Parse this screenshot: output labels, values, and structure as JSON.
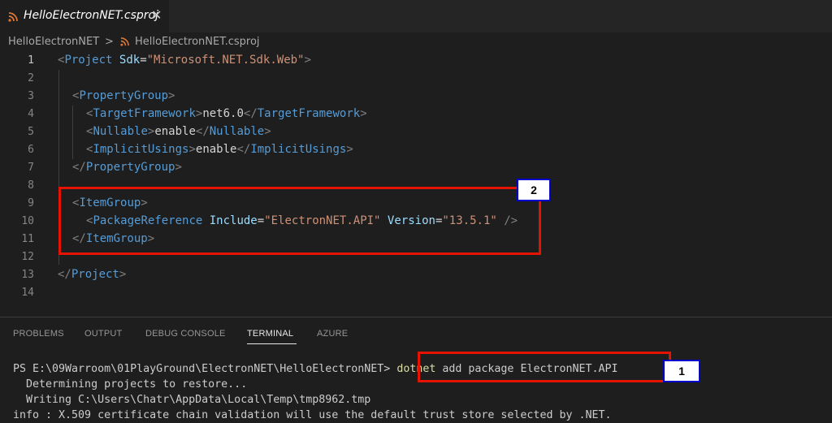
{
  "tab": {
    "title": "HelloElectronNET.csproj",
    "close": "✕"
  },
  "breadcrumb": {
    "folder": "HelloElectronNET",
    "sep": ">",
    "file": "HelloElectronNET.csproj"
  },
  "line_numbers": [
    "1",
    "2",
    "3",
    "4",
    "5",
    "6",
    "7",
    "8",
    "9",
    "10",
    "11",
    "12",
    "13",
    "14"
  ],
  "code": {
    "l1": {
      "open": "<",
      "tag": "Project",
      "attr": "Sdk",
      "eq": "=",
      "val": "\"Microsoft.NET.Sdk.Web\"",
      "close": ">"
    },
    "l3": {
      "open": "<",
      "tag": "PropertyGroup",
      "close": ">"
    },
    "l4": {
      "open": "<",
      "tag": "TargetFramework",
      "close": ">",
      "text": "net6.0",
      "eopen": "</",
      "etag": "TargetFramework",
      "eclose": ">"
    },
    "l5": {
      "open": "<",
      "tag": "Nullable",
      "close": ">",
      "text": "enable",
      "eopen": "</",
      "etag": "Nullable",
      "eclose": ">"
    },
    "l6": {
      "open": "<",
      "tag": "ImplicitUsings",
      "close": ">",
      "text": "enable",
      "eopen": "</",
      "etag": "ImplicitUsings",
      "eclose": ">"
    },
    "l7": {
      "open": "</",
      "tag": "PropertyGroup",
      "close": ">"
    },
    "l9": {
      "open": "<",
      "tag": "ItemGroup",
      "close": ">"
    },
    "l10": {
      "open": "<",
      "tag": "PackageReference",
      "attr1": "Include",
      "eq": "=",
      "val1": "\"ElectronNET.API\"",
      "attr2": "Version",
      "val2": "\"13.5.1\"",
      "close": " />"
    },
    "l11": {
      "open": "</",
      "tag": "ItemGroup",
      "close": ">"
    },
    "l13": {
      "open": "</",
      "tag": "Project",
      "close": ">"
    }
  },
  "badges": {
    "one": "1",
    "two": "2"
  },
  "panel": {
    "tabs": [
      "PROBLEMS",
      "OUTPUT",
      "DEBUG CONSOLE",
      "TERMINAL",
      "AZURE"
    ],
    "active": "TERMINAL"
  },
  "terminal": {
    "prompt": "PS E:\\09Warroom\\01PlayGround\\ElectronNET\\HelloElectronNET> ",
    "cmd": "dotnet",
    "args": " add package ElectronNET.API",
    "line2": "  Determining projects to restore...",
    "line3": "  Writing C:\\Users\\Chatr\\AppData\\Local\\Temp\\tmp8962.tmp",
    "line4": "info : X.509 certificate chain validation will use the default trust store selected by .NET."
  },
  "colors": {
    "highlight_box": "#e51400",
    "badge_border": "#0000cc",
    "rss_icon": "#e37933"
  },
  "icons": {
    "tab_icon": "rss-icon",
    "crumb_icon": "rss-icon"
  }
}
